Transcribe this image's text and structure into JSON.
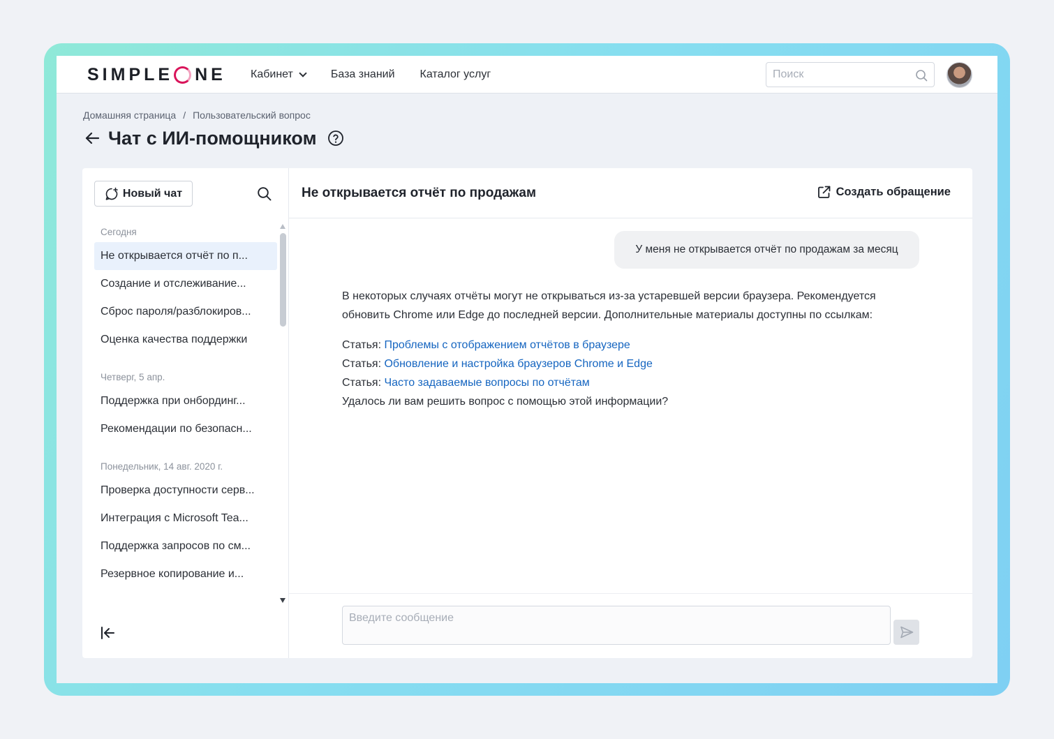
{
  "header": {
    "logo_left": "SIMPLE",
    "logo_right": "NE",
    "nav": [
      {
        "label": "Кабинет",
        "has_dropdown": true
      },
      {
        "label": "База знаний",
        "has_dropdown": false
      },
      {
        "label": "Каталог услуг",
        "has_dropdown": false
      }
    ],
    "search_placeholder": "Поиск"
  },
  "breadcrumb": {
    "items": [
      "Домашняя страница",
      "Пользовательский вопрос"
    ],
    "separator": "/"
  },
  "page": {
    "title": "Чат с ИИ-помощником"
  },
  "sidebar": {
    "new_chat_label": "Новый чат",
    "groups": [
      {
        "label": "Сегодня",
        "items": [
          "Не открывается отчёт по п...",
          "Создание и отслеживание...",
          "Сброс пароля/разблокиров...",
          "Оценка качества поддержки"
        ]
      },
      {
        "label": "Четверг, 5 апр.",
        "items": [
          "Поддержка при онбординг...",
          "Рекомендации по безопасн..."
        ]
      },
      {
        "label": "Понедельник, 14 авг. 2020 г.",
        "items": [
          "Проверка доступности серв...",
          "Интеграция с Microsoft Tea...",
          "Поддержка запросов по см...",
          "Резервное копирование и..."
        ]
      }
    ]
  },
  "chat": {
    "title": "Не открывается отчёт по продажам",
    "create_ticket_label": "Создать обращение",
    "user_message": "У меня не открывается отчёт по продажам за месяц",
    "bot_message": {
      "intro": "В некоторых случаях отчёты могут не открываться из-за устаревшей версии браузера. Рекомендуется обновить Chrome или Edge до последней версии. Дополнительные материалы доступны по ссылкам:",
      "links": [
        {
          "prefix": "Статья:",
          "text": "Проблемы с отображением отчётов в браузере"
        },
        {
          "prefix": "Статья:",
          "text": "Обновление и настройка браузеров Chrome и Edge"
        },
        {
          "prefix": "Статья:",
          "text": "Часто задаваемые вопросы по отчётам"
        }
      ],
      "question": "Удалось ли вам решить вопрос с помощью этой информации?"
    },
    "composer_placeholder": "Введите сообщение"
  },
  "colors": {
    "brand_accent": "#d9145a",
    "link": "#1565c0",
    "active_item_bg": "#e9f1fc",
    "frame_gradient_start": "#8fe9d8",
    "frame_gradient_end": "#7fd0f3"
  },
  "icons": [
    "chevron-down-icon",
    "search-icon",
    "avatar",
    "arrow-left-icon",
    "help-circle-icon",
    "new-chat-icon",
    "external-link-icon",
    "collapse-sidebar-icon",
    "send-icon"
  ]
}
